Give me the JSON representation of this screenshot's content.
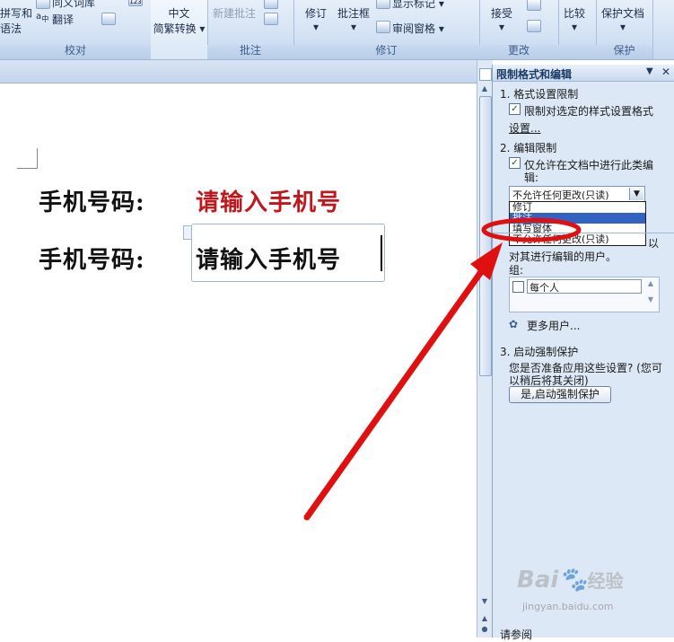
{
  "ribbon": {
    "proofing": {
      "item1": "拼写和",
      "item2": "语法",
      "thesaurus": "同义词库",
      "translate": "翻译",
      "group": "校对"
    },
    "chinese": {
      "line1": "中文",
      "line2": "简繁转换"
    },
    "comments": {
      "new": "新建批注",
      "group": "批注"
    },
    "tracking": {
      "track": "修订",
      "balloons": "批注框",
      "show_markup": "显示标记",
      "reviewing_pane": "审阅窗格",
      "group": "修订"
    },
    "changes": {
      "accept": "接受",
      "group": "更改"
    },
    "compare": {
      "label": "比较"
    },
    "protect": {
      "label": "保护文档",
      "group": "保护"
    }
  },
  "document": {
    "line1_label": "手机号码:",
    "line1_value": "请输入手机号",
    "line2_label": "手机号码:",
    "line2_value": "请输入手机号"
  },
  "pane": {
    "title": "限制格式和编辑",
    "section1": "1. 格式设置限制",
    "check1_text": "限制对选定的样式设置格式",
    "check1_text2": "设置...",
    "section2": "2. 编辑限制",
    "check2_text": "仅允许在文档中进行此类编",
    "check2_text2": "辑:",
    "dropdown_value": "不允许任何更改(只读)",
    "dropdown_options": [
      "修订",
      "批注",
      "填写窗体",
      "不允许任何更改(只读)"
    ],
    "exceptions_text1": "对其进行编辑的用户。",
    "exceptions_tail": "以",
    "groups_label": "组:",
    "group_everyone": "每个人",
    "more_users": "更多用户...",
    "section3": "3. 启动强制保护",
    "prompt_text1": "您是否准备应用这些设置? (您可",
    "prompt_text2": "以稍后将其关闭)",
    "start_button": "是,启动强制保护",
    "see_also": "请参阅"
  },
  "watermark": {
    "brand": "Bai",
    "brand2": "经验",
    "url": "jingyan.baidu.com"
  },
  "colors": {
    "annotation_red": "#e01010",
    "document_red": "#c0171c",
    "ribbon_blue": "#d4e2f4",
    "selection_blue": "#3163c5"
  }
}
